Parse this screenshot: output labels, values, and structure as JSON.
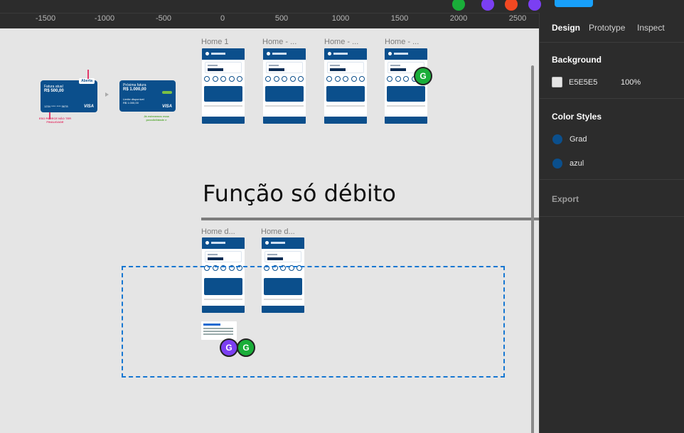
{
  "ruler": {
    "ticks": [
      "-1500",
      "-1000",
      "-500",
      "0",
      "500",
      "1000",
      "1500",
      "2000",
      "2500"
    ]
  },
  "panel": {
    "tabs": [
      "Design",
      "Prototype",
      "Inspect"
    ],
    "background": {
      "title": "Background",
      "hex": "E5E5E5",
      "opacity": "100%"
    },
    "color_styles": {
      "title": "Color Styles",
      "items": [
        "Grad",
        "azul"
      ]
    },
    "export_label": "Export"
  },
  "canvas": {
    "frames_top": [
      "Home 1",
      "Home - ...",
      "Home - ...",
      "Home - ..."
    ],
    "frames_bottom": [
      "Home d...",
      "Home d..."
    ],
    "section_title": "Função só débito",
    "card1": {
      "badge": "Aberta",
      "title": "Fatura atual",
      "amount": "R$ 500,00",
      "number": "1234 **** **** 5678",
      "brand": "VISA"
    },
    "card2": {
      "title": "Próxima fatura",
      "amount": "R$ 1.000,00",
      "limit_label": "Limite disponível",
      "limit": "R$ 1.000,00",
      "brand": "VISA"
    },
    "note_red": "ESO PARECE NÃO TER FINALIDADE",
    "note_green": "Já estreamos essa possibilidade e",
    "collaborators": [
      "G",
      "G",
      "G"
    ]
  },
  "colors": {
    "canvas_bg": "#E5E5E5",
    "grad": "#0b4f8c",
    "azul": "#0b4f8c",
    "accent": "#18a0fb",
    "dashed": "#1677d2"
  }
}
